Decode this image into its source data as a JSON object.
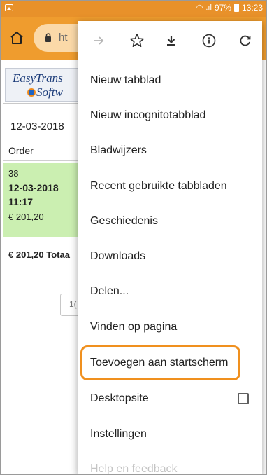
{
  "status_bar": {
    "signal_text": ".ıl",
    "battery_percent": "97%",
    "time": "13:23"
  },
  "toolbar": {
    "url_partial": "ht"
  },
  "page": {
    "logo": {
      "line1": "EasyTrans",
      "line2": "Softw"
    },
    "date_header": "12-03-2018",
    "order_header": "Order",
    "order": {
      "id": "38",
      "date": "12-03-2018",
      "time": "11:17",
      "price": "€ 201,20"
    },
    "total": "€ 201,20 Totaa",
    "pager": "1("
  },
  "menu": {
    "toolbar_icons": [
      "forward-arrow-icon",
      "star-icon",
      "download-icon",
      "info-icon",
      "reload-icon"
    ],
    "items": [
      {
        "label": "Nieuw tabblad"
      },
      {
        "label": "Nieuw incognitotabblad"
      },
      {
        "label": "Bladwijzers"
      },
      {
        "label": "Recent gebruikte tabbladen"
      },
      {
        "label": "Geschiedenis"
      },
      {
        "label": "Downloads"
      },
      {
        "label": "Delen..."
      },
      {
        "label": "Vinden op pagina"
      },
      {
        "label": "Toevoegen aan startscherm",
        "highlighted": true
      },
      {
        "label": "Desktopsite",
        "checkbox": false
      },
      {
        "label": "Instellingen"
      },
      {
        "label": "Help en feedback"
      }
    ]
  },
  "colors": {
    "status_bar": "#e8912a",
    "toolbar": "#ef9c2e",
    "highlight": "#f0901e",
    "order_card": "#cbefb1"
  }
}
